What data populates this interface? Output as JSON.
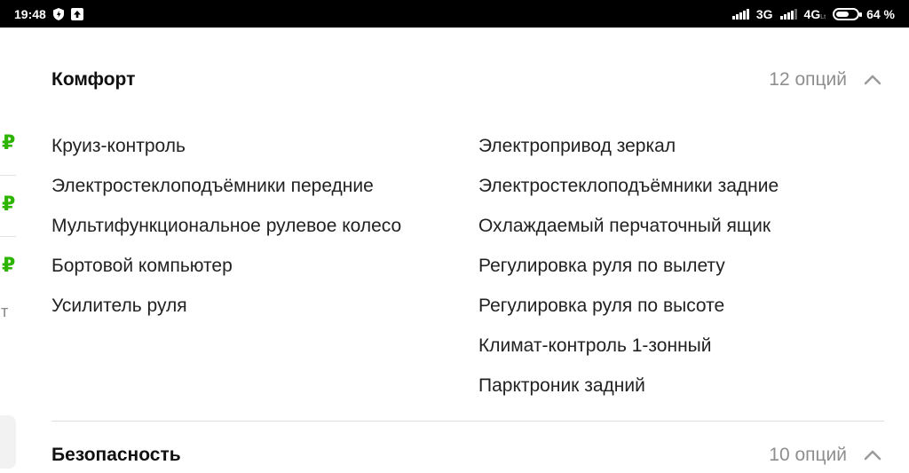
{
  "status_bar": {
    "time": "19:48",
    "network1": "3G",
    "network2": "4G",
    "network2_suffix": "Lt",
    "battery_percent": "64 %",
    "battery_level": 0.64,
    "icons": [
      "shield-icon",
      "upload-icon",
      "signal-icon",
      "battery-icon"
    ]
  },
  "edge": {
    "ruble_symbol": "₽",
    "partial_letter": "т"
  },
  "comfort": {
    "title": "Комфорт",
    "count": "12 опций",
    "expanded": true,
    "left_options": [
      "Круиз-контроль",
      "Электростеклоподъёмники передние",
      "Мультифункциональное рулевое колесо",
      "Бортовой компьютер",
      "Усилитель руля"
    ],
    "right_options": [
      "Электропривод зеркал",
      "Электростеклоподъёмники задние",
      "Охлаждаемый перчаточный ящик",
      "Регулировка руля по вылету",
      "Регулировка руля по высоте",
      "Климат-контроль 1-зонный",
      "Парктроник задний"
    ]
  },
  "safety": {
    "title": "Безопасность",
    "count": "10 опций"
  },
  "colors": {
    "accent_green": "#2db400",
    "muted_gray": "#8e8e8e",
    "status_bar_bg": "#000000"
  }
}
